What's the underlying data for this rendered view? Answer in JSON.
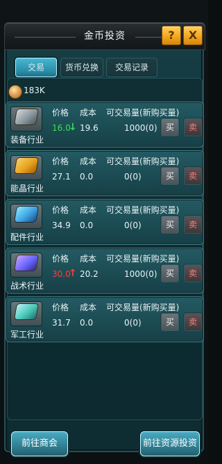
{
  "header": {
    "title": "金币投资",
    "help_label": "?",
    "close_label": "X"
  },
  "tabs": [
    {
      "label": "交易"
    },
    {
      "label": "货币兑换"
    },
    {
      "label": "交易记录"
    }
  ],
  "currency": {
    "amount": "183K"
  },
  "table": {
    "headers": {
      "price": "价格",
      "cost": "成本",
      "tradeable": "可交易量(新购买量)"
    },
    "rows": [
      {
        "name": "装备行业",
        "price": "16.0",
        "trend": "down",
        "cost": "19.6",
        "tradeable": "1000(0)",
        "buy": "买",
        "sell": "卖"
      },
      {
        "name": "能晶行业",
        "price": "27.1",
        "trend": "",
        "cost": "0.0",
        "tradeable": "0(0)",
        "buy": "买",
        "sell": "卖"
      },
      {
        "name": "配件行业",
        "price": "34.9",
        "trend": "",
        "cost": "0.0",
        "tradeable": "0(0)",
        "buy": "买",
        "sell": "卖"
      },
      {
        "name": "战术行业",
        "price": "30.0",
        "trend": "up",
        "cost": "20.2",
        "tradeable": "1000(0)",
        "buy": "买",
        "sell": "卖"
      },
      {
        "name": "军工行业",
        "price": "31.7",
        "trend": "",
        "cost": "0.0",
        "tradeable": "0(0)",
        "buy": "买",
        "sell": "卖"
      }
    ]
  },
  "footer": {
    "left_button": "前往商会",
    "right_button": "前往资源投资"
  },
  "icons": {
    "help": "help-icon",
    "close": "close-icon",
    "coin": "coin-icon",
    "trend_down": "arrow-down-icon",
    "trend_up": "arrow-up-icon"
  },
  "colors": {
    "panel": "#0f3036",
    "accent": "#2a8ea8",
    "gold": "#f2a71f",
    "green": "#38e24f",
    "red": "#ff3d3d"
  }
}
